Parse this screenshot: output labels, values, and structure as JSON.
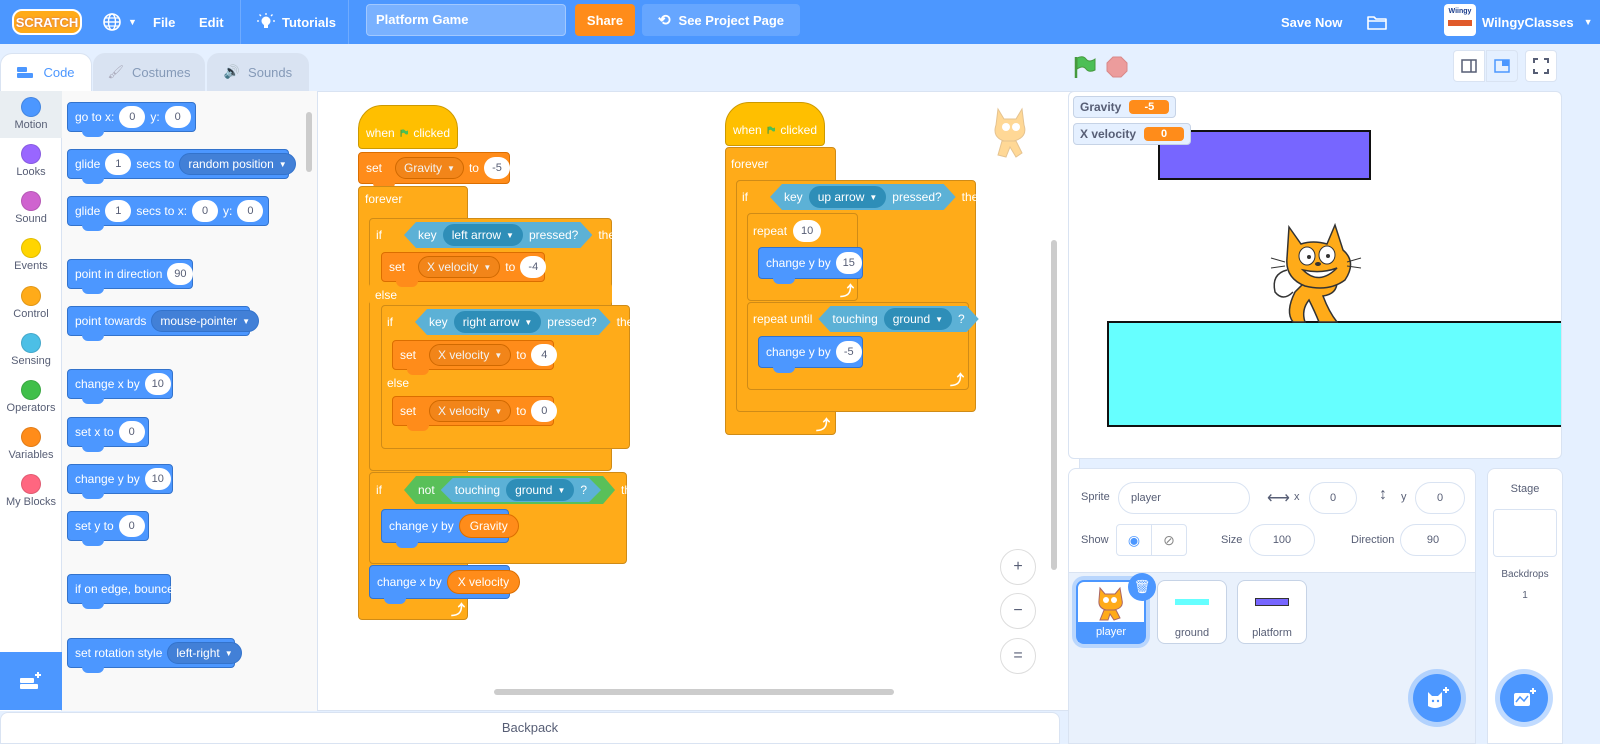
{
  "menubar": {
    "logo": "SCRATCH",
    "file": "File",
    "edit": "Edit",
    "tutorials": "Tutorials",
    "project_title": "Platform Game",
    "share": "Share",
    "see_project_page": "See Project Page",
    "save_now": "Save Now",
    "username": "WilngyClasses",
    "avatar_text": "Wiingy"
  },
  "tabs": [
    {
      "label": "Code"
    },
    {
      "label": "Costumes"
    },
    {
      "label": "Sounds"
    }
  ],
  "categories": [
    {
      "label": "Motion",
      "color": "#4c97ff"
    },
    {
      "label": "Looks",
      "color": "#9966ff"
    },
    {
      "label": "Sound",
      "color": "#cf63cf"
    },
    {
      "label": "Events",
      "color": "#ffd500"
    },
    {
      "label": "Control",
      "color": "#ffab19"
    },
    {
      "label": "Sensing",
      "color": "#4cbfe6"
    },
    {
      "label": "Operators",
      "color": "#40bf4a"
    },
    {
      "label": "Variables",
      "color": "#ff8c1a"
    },
    {
      "label": "My Blocks",
      "color": "#ff6680"
    }
  ],
  "palette": {
    "goto": {
      "t1": "go to x:",
      "x": "0",
      "t2": "y:",
      "y": "0"
    },
    "glide_to": {
      "t1": "glide",
      "secs": "1",
      "t2": "secs to",
      "target": "random position"
    },
    "glide_xy": {
      "t1": "glide",
      "secs": "1",
      "t2": "secs to x:",
      "x": "0",
      "t3": "y:",
      "y": "0"
    },
    "point_dir": {
      "t1": "point in direction",
      "v": "90"
    },
    "point_towards": {
      "t1": "point towards",
      "target": "mouse-pointer"
    },
    "change_x": {
      "t1": "change x by",
      "v": "10"
    },
    "set_x": {
      "t1": "set x to",
      "v": "0"
    },
    "change_y": {
      "t1": "change y by",
      "v": "10"
    },
    "set_y": {
      "t1": "set y to",
      "v": "0"
    },
    "bounce": {
      "t1": "if on edge, bounce"
    },
    "rotation": {
      "t1": "set rotation style",
      "v": "left-right"
    }
  },
  "script1": {
    "hat": {
      "when": "when",
      "clicked": "clicked"
    },
    "set_gravity": {
      "set": "set",
      "var": "Gravity",
      "to": "to",
      "val": "-5"
    },
    "forever": "forever",
    "if1": {
      "if": "if",
      "key": "key",
      "keyname": "left arrow",
      "pressed": "pressed?",
      "then": "then"
    },
    "set_xv_left": {
      "set": "set",
      "var": "X velocity",
      "to": "to",
      "val": "-4"
    },
    "else1": "else",
    "if2": {
      "if": "if",
      "key": "key",
      "keyname": "right arrow",
      "pressed": "pressed?",
      "then": "then"
    },
    "set_xv_right": {
      "set": "set",
      "var": "X velocity",
      "to": "to",
      "val": "4"
    },
    "else2": "else",
    "set_xv_zero": {
      "set": "set",
      "var": "X velocity",
      "to": "to",
      "val": "0"
    },
    "if3": {
      "if": "if",
      "not": "not",
      "touching": "touching",
      "obj": "ground",
      "q": "?",
      "then": "then"
    },
    "change_y_grav": {
      "label": "change y by",
      "var": "Gravity"
    },
    "change_x_xv": {
      "label": "change x by",
      "var": "X velocity"
    }
  },
  "script2": {
    "hat": {
      "when": "when",
      "clicked": "clicked"
    },
    "forever": "forever",
    "if1": {
      "if": "if",
      "key": "key",
      "keyname": "up arrow",
      "pressed": "pressed?",
      "then": "then"
    },
    "repeat": {
      "label": "repeat",
      "val": "10"
    },
    "change_y_up": {
      "label": "change y by",
      "val": "15"
    },
    "repeat_until": {
      "label": "repeat until",
      "touching": "touching",
      "obj": "ground",
      "q": "?"
    },
    "change_y_down": {
      "label": "change y by",
      "val": "-5"
    }
  },
  "workspace": {
    "zoom_in": "+",
    "zoom_out": "−",
    "reset": "="
  },
  "backpack": "Backpack",
  "stage": {
    "monitors": [
      {
        "label": "Gravity",
        "value": "-5"
      },
      {
        "label": "X velocity",
        "value": "0"
      }
    ],
    "colors": {
      "platform": "#7766ff",
      "ground": "#66ffff"
    }
  },
  "sprite_info": {
    "sprite_label": "Sprite",
    "sprite_name": "player",
    "x_label": "x",
    "x": "0",
    "y_label": "y",
    "y": "0",
    "show_label": "Show",
    "size_label": "Size",
    "size": "100",
    "direction_label": "Direction",
    "direction": "90"
  },
  "sprites": [
    {
      "name": "player",
      "selected": true
    },
    {
      "name": "ground",
      "selected": false
    },
    {
      "name": "platform",
      "selected": false
    }
  ],
  "stage_pane": {
    "title": "Stage",
    "backdrops_label": "Backdrops",
    "backdrops_count": "1"
  }
}
